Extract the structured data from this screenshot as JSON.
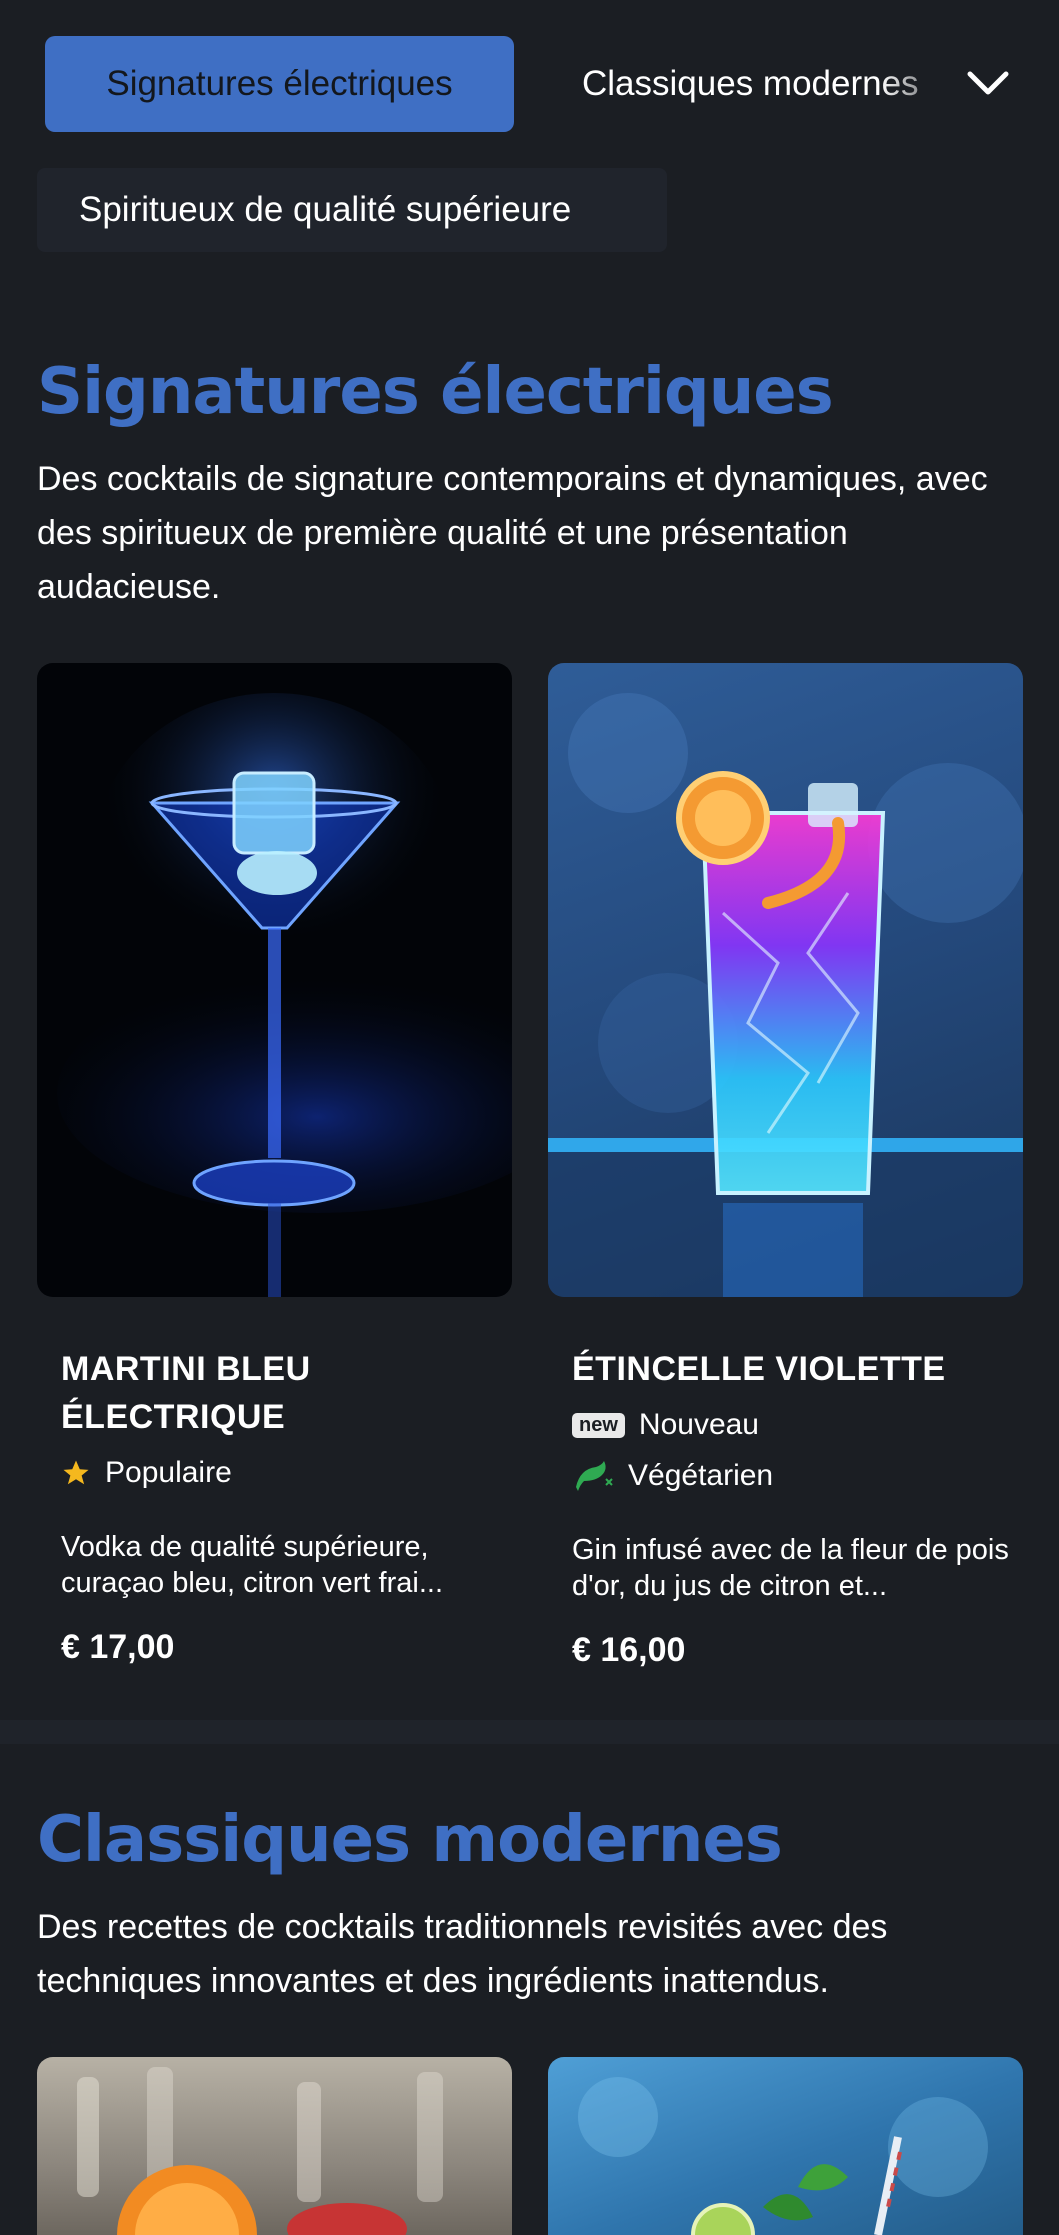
{
  "nav": {
    "active": "Signatures électriques",
    "next": "Classiques modernes",
    "secondary": "Spiritueux de qualité supérieure",
    "chevron_icon": "chevron-down-icon"
  },
  "sections": [
    {
      "title": "Signatures électriques",
      "description": "Des cocktails de signature contemporains et dynamiques, avec des spiritueux de première qualité et une présentation audacieuse.",
      "items": [
        {
          "name_line1": "MARTINI BLEU",
          "name_line2": "ÉLECTRIQUE",
          "tags": [
            {
              "icon": "star-icon",
              "label": "Populaire"
            }
          ],
          "description": "Vodka de qualité supérieure, curaçao bleu, citron vert frai...",
          "price": "€ 17,00"
        },
        {
          "name_line1": "ÉTINCELLE VIOLETTE",
          "tags": [
            {
              "badge": "new",
              "label": "Nouveau"
            },
            {
              "icon": "vegetarian-icon",
              "label": "Végétarien"
            }
          ],
          "description": "Gin infusé avec de la fleur de pois d'or, du jus de citron et...",
          "price": "€ 16,00"
        }
      ]
    },
    {
      "title": "Classiques modernes",
      "description": "Des recettes de cocktails traditionnels revisités avec des techniques innovantes et des ingrédients inattendus."
    }
  ],
  "colors": {
    "background": "#1b1e23",
    "accent": "#3f6fc4",
    "star": "#f5b81e",
    "vegetarian": "#2faa52"
  }
}
